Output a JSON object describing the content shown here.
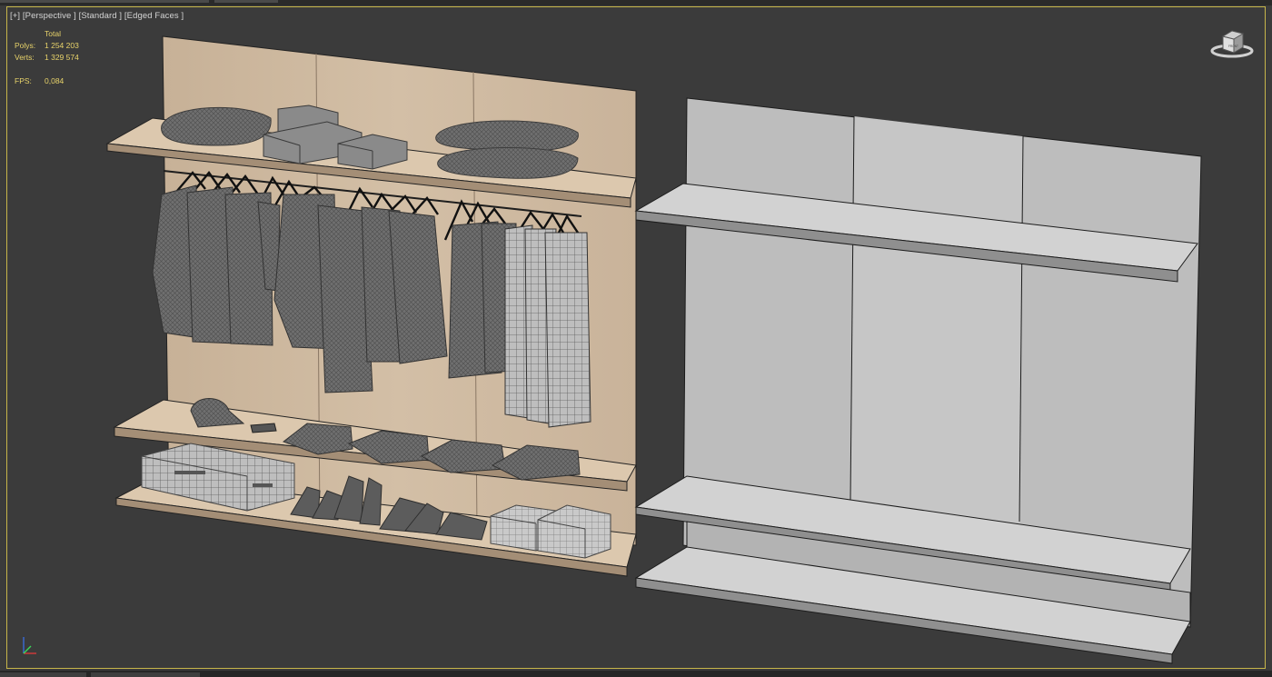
{
  "viewport": {
    "labels": [
      "[+]",
      "[Perspective ]",
      "[Standard ]",
      "[Edged Faces ]"
    ]
  },
  "stats": {
    "total_label": "Total",
    "polys_label": "Polys:",
    "polys_value": "1 254 203",
    "verts_label": "Verts:",
    "verts_value": "1 329 574",
    "fps_label": "FPS:",
    "fps_value": "0,084"
  },
  "viewcube": {
    "face_label": "FRONT"
  },
  "colors": {
    "viewport_bg": "#3b3b3b",
    "frame_border": "#c7b64a",
    "stats_text": "#e8d36a",
    "wood_panel": "#cdb8a0",
    "wood_shelf": "#d9c5ab",
    "white_panel": "#bdbdbd",
    "mesh_gray": "#6e6e6e"
  },
  "icons": [
    "viewcube-icon",
    "axis-tripod-icon"
  ]
}
